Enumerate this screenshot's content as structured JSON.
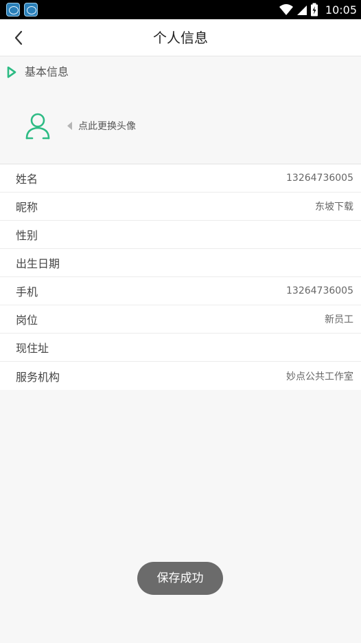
{
  "status_bar": {
    "time": "10:05",
    "icons": [
      "app-icon",
      "app-icon",
      "wifi-icon",
      "signal-icon",
      "battery-icon"
    ]
  },
  "header": {
    "title": "个人信息",
    "back_icon": "chevron-left-icon"
  },
  "section": {
    "title": "基本信息",
    "icon": "play-outline-icon",
    "accent_color": "#2dbb84"
  },
  "avatar": {
    "icon": "user-outline-icon",
    "hint": "点此更换头像"
  },
  "fields": [
    {
      "label": "姓名",
      "value": "13264736005"
    },
    {
      "label": "昵称",
      "value": "东坡下载"
    },
    {
      "label": "性别",
      "value": ""
    },
    {
      "label": "出生日期",
      "value": ""
    },
    {
      "label": "手机",
      "value": "13264736005"
    },
    {
      "label": "岗位",
      "value": "新员工"
    },
    {
      "label": "现住址",
      "value": ""
    },
    {
      "label": "服务机构",
      "value": "妙点公共工作室"
    }
  ],
  "toast": {
    "message": "保存成功"
  }
}
